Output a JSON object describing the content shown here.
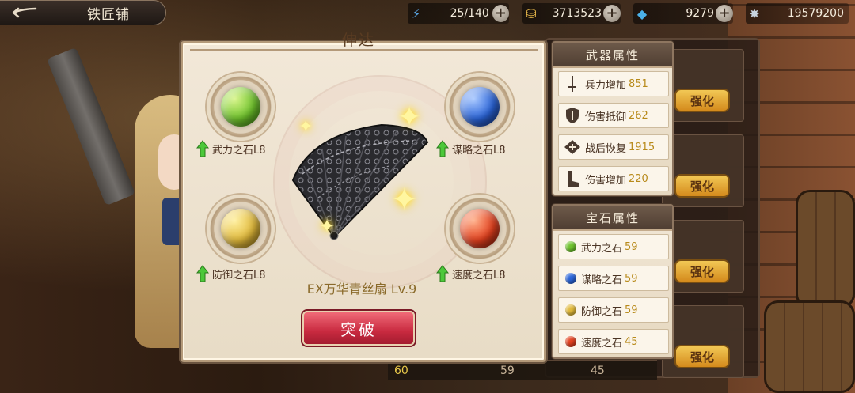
{
  "header": {
    "title": "铁匠铺",
    "back_icon": "back-arrow-icon"
  },
  "resources": [
    {
      "name": "stamina",
      "icon": "lightning-icon",
      "value": "25/140"
    },
    {
      "name": "gold",
      "icon": "coin-icon",
      "value": "3713523"
    },
    {
      "name": "gems",
      "icon": "crystal-icon",
      "value": "9279"
    },
    {
      "name": "power",
      "icon": "star-icon",
      "value": "19579200"
    }
  ],
  "panel": {
    "title": "伸达",
    "weapon_name": "EX万华青丝扇 Lv.9",
    "break_label": "突破",
    "gems": [
      {
        "label": "武力之石L8",
        "color": "#6ec22c"
      },
      {
        "label": "谋略之石L8",
        "color": "#2a64d8"
      },
      {
        "label": "防御之石L8",
        "color": "#e0b83a"
      },
      {
        "label": "速度之石L8",
        "color": "#e2401e"
      }
    ]
  },
  "weapon_attrs": {
    "title": "武器属性",
    "rows": [
      {
        "label": "兵力增加",
        "value": "851",
        "icon": "sword-icon"
      },
      {
        "label": "伤害抵御",
        "value": "262",
        "icon": "shield-icon"
      },
      {
        "label": "战后恢复",
        "value": "1915",
        "icon": "heal-icon"
      },
      {
        "label": "伤害增加",
        "value": "220",
        "icon": "boot-icon"
      }
    ]
  },
  "gem_attrs": {
    "title": "宝石属性",
    "rows": [
      {
        "label": "武力之石",
        "value": "59",
        "color": "#6ec22c"
      },
      {
        "label": "谋略之石",
        "value": "59",
        "color": "#2a64d8"
      },
      {
        "label": "防御之石",
        "value": "59",
        "color": "#e0b83a"
      },
      {
        "label": "速度之石",
        "value": "45",
        "color": "#e2401e"
      }
    ]
  },
  "background_list": {
    "enhance_label": "强化",
    "bottom_values": [
      "60",
      "59",
      "45"
    ]
  },
  "colors": {
    "panel_bg": "#f2e8d8",
    "break_button": "#c92a40",
    "enhance_button": "#f2c855",
    "value_gold": "#b88a1a"
  }
}
